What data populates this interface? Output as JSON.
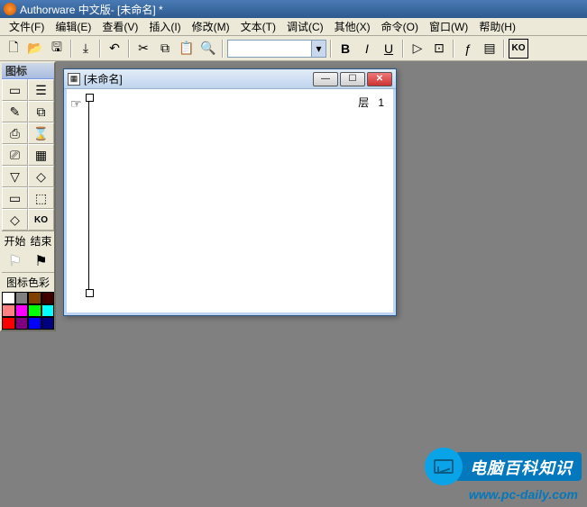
{
  "title": "Authorware 中文版- [未命名] *",
  "menus": [
    "文件(F)",
    "编辑(E)",
    "查看(V)",
    "插入(I)",
    "修改(M)",
    "文本(T)",
    "调试(C)",
    "其他(X)",
    "命令(O)",
    "窗口(W)",
    "帮助(H)"
  ],
  "toolbar": {
    "new": "🗋",
    "open": "📂",
    "save_all": "🖫",
    "import": "⤓",
    "undo": "↶",
    "cut": "✂",
    "copy": "⧉",
    "paste": "📋",
    "find": "🔍",
    "bold": "B",
    "italic": "I",
    "underline": "U",
    "run": "▷",
    "control": "⊡",
    "func": "ƒ",
    "var": "▤",
    "ko": "KO"
  },
  "iconpanel": {
    "title": "图标",
    "tools": [
      "▭",
      "☰",
      "✎",
      "⧉",
      "⎙",
      "⌛",
      "⎚",
      "▦",
      "▽",
      "◇",
      "▭",
      "⬚",
      "◇",
      "KO"
    ],
    "start": "开始",
    "end": "结束",
    "palette_title": "图标色彩",
    "colors": [
      "#ffffff",
      "#808080",
      "#804000",
      "#400000",
      "#ff8080",
      "#ff00ff",
      "#00ff00",
      "#00ffff",
      "#ff0000",
      "#800080",
      "#0000ff",
      "#000080"
    ]
  },
  "document": {
    "title": "[未命名]",
    "layer_label": "层",
    "layer_value": "1"
  },
  "watermark": {
    "text": "电脑百科知识",
    "url": "www.pc-daily.com"
  }
}
